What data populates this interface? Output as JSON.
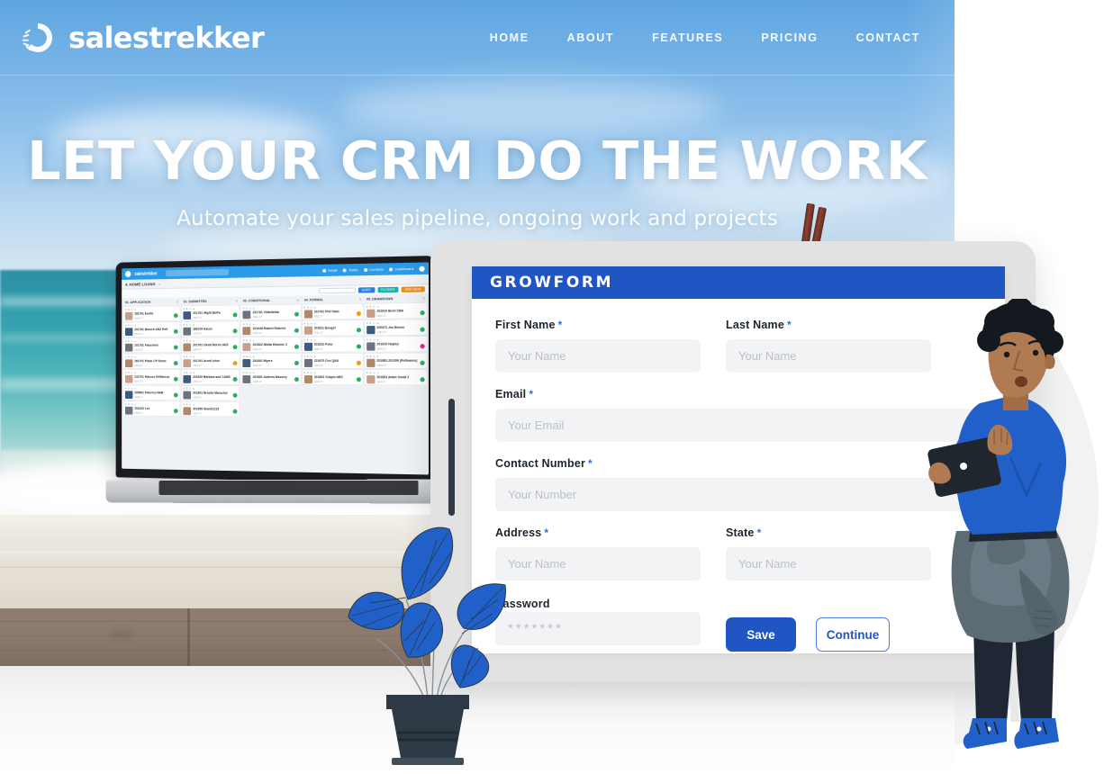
{
  "navbar": {
    "brand": "salestrekker",
    "logo_icon": "salestrekker-circular-logo-icon",
    "links": [
      {
        "label": "HOME"
      },
      {
        "label": "ABOUT"
      },
      {
        "label": "FEATURES"
      },
      {
        "label": "PRICING"
      },
      {
        "label": "CONTACT"
      }
    ]
  },
  "hero": {
    "title": "LET YOUR CRM DO THE WORK",
    "subtitle": "Automate your sales pipeline, ongoing work and projects",
    "background": "beach-ocean-wooden-deck-photo"
  },
  "form": {
    "header_title": "GROWFORM",
    "required_marker": "*",
    "fields": [
      {
        "label": "First Name",
        "required": true,
        "placeholder": "Your Name",
        "value": ""
      },
      {
        "label": "Last Name",
        "required": true,
        "placeholder": "Your Name",
        "value": ""
      },
      {
        "label": "Email",
        "required": true,
        "placeholder": "Your Email",
        "value": ""
      },
      {
        "label": "Contact  Number",
        "required": true,
        "placeholder": "Your Number",
        "value": ""
      },
      {
        "label": "Address",
        "required": true,
        "placeholder": "Your Name",
        "value": ""
      },
      {
        "label": "State",
        "required": true,
        "placeholder": "Your Name",
        "value": ""
      },
      {
        "label": "Password",
        "required": false,
        "placeholder": "*******",
        "value": ""
      }
    ],
    "buttons": {
      "save": "Save",
      "continue": "Continue"
    },
    "colors": {
      "header_blue": "#2255c4",
      "accent_blue": "#2f6be0",
      "input_bg": "#f2f3f5"
    }
  },
  "laptop": {
    "app_name": "salestrekker",
    "search_placeholder": "Search",
    "topbar_items": [
      "Deals",
      "Tasks",
      "Contacts",
      "Dashboard"
    ],
    "breadcrumb": "4. HOME LOANS",
    "toolbar_buttons": [
      "SORT",
      "FILTERS",
      "ADD NEW"
    ],
    "columns": [
      {
        "title": "01. APPLICATION",
        "count": "5",
        "cards": [
          {
            "name": "281761 Evetts",
            "meta": "1016.17",
            "status": "green"
          },
          {
            "name": "201761 Baruch ANZ Refi",
            "meta": "1610.17",
            "status": "green"
          },
          {
            "name": "201761 Flaschner",
            "meta": "1904.17",
            "status": "green"
          },
          {
            "name": "261701 Plank CP Demo",
            "meta": "1904.17",
            "status": "green"
          },
          {
            "name": "231701 Marcus DeMarcus",
            "meta": "1607.17",
            "status": "green"
          },
          {
            "name": "205601 Palermo NAB",
            "meta": "1606.17",
            "status": "green"
          },
          {
            "name": "201610 Lee",
            "meta": "1509.17",
            "status": "green"
          }
        ]
      },
      {
        "title": "02. SUBMITTED",
        "count": "6",
        "cards": [
          {
            "name": "201761 Wipfli BUPa",
            "meta": "1901.17",
            "status": "green"
          },
          {
            "name": "186154 Kaiser",
            "meta": "1709.17",
            "status": "green"
          },
          {
            "name": "201761 Olivia Morris ANZ",
            "meta": "1804.17",
            "status": "green"
          },
          {
            "name": "201761 Arnell Ishin",
            "meta": "1603.17",
            "status": "orange"
          },
          {
            "name": "201640 Barbara and CAMX",
            "meta": "1507.17",
            "status": "green"
          },
          {
            "name": "201601 Brooks Marschel",
            "meta": "1409.17",
            "status": "green"
          },
          {
            "name": "201650 Shank1215",
            "meta": "1307.17",
            "status": "green"
          }
        ]
      },
      {
        "title": "03. CONDITIONAL",
        "count": "6",
        "cards": [
          {
            "name": "201761 Villanfolda",
            "meta": "1808.17",
            "status": "green"
          },
          {
            "name": "201648 Robert Roberts",
            "meta": "1705.17",
            "status": "green"
          },
          {
            "name": "201822 Nikita Kfasmic 2",
            "meta": "1604.17",
            "status": "green"
          },
          {
            "name": "203401 Myers",
            "meta": "1502.17",
            "status": "green"
          },
          {
            "name": "201661 Andrew Mooney",
            "meta": "1403.17",
            "status": "green"
          }
        ]
      },
      {
        "title": "04. FORMAL",
        "count": "5",
        "cards": [
          {
            "name": "201761 Phil Oaks",
            "meta": "1802.17",
            "status": "orange"
          },
          {
            "name": "201611 Bouget",
            "meta": "1702.17",
            "status": "green"
          },
          {
            "name": "201610 Peter",
            "meta": "1606.17",
            "status": "green"
          },
          {
            "name": "221670 Cen Q&A",
            "meta": "1502.17",
            "status": "orange"
          },
          {
            "name": "201603 Chapin ABC",
            "meta": "1405.17",
            "status": "green"
          }
        ]
      },
      {
        "title": "05. DRAWDOWN",
        "count": "6",
        "cards": [
          {
            "name": "201610 Bevil CBA",
            "meta": "1801.17",
            "status": "green"
          },
          {
            "name": "200471 Joe Brown",
            "meta": "1706.17",
            "status": "green"
          },
          {
            "name": "201610 Hopley",
            "meta": "1608.17",
            "status": "pink"
          },
          {
            "name": "201681-201206 (Refinance)",
            "meta": "1504.17",
            "status": "green"
          },
          {
            "name": "201603 Adam Small 2",
            "meta": "1404.17",
            "status": "green"
          }
        ]
      }
    ]
  },
  "illustrations": {
    "person": "person-holding-tablet-illustration",
    "plant": "potted-plant-blue-leaves-illustration",
    "pencils": "pencils-in-holder"
  }
}
